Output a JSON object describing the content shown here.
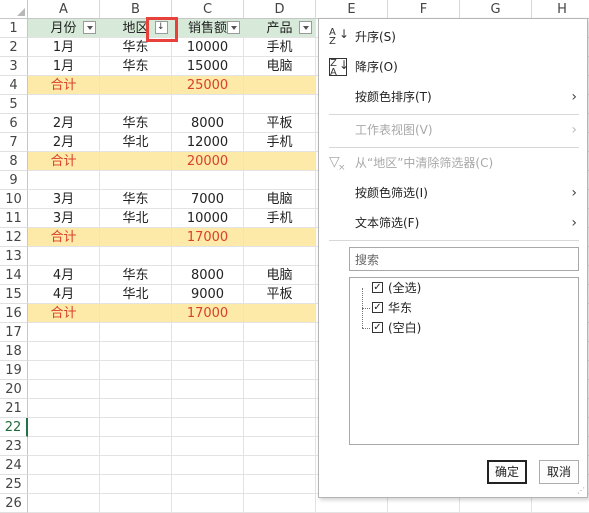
{
  "columns": [
    "A",
    "B",
    "C",
    "D",
    "E",
    "F",
    "G",
    "H"
  ],
  "rows": [
    {
      "n": "1",
      "type": "header",
      "a": "月份",
      "b": "地区",
      "c": "销售额",
      "d": "产品"
    },
    {
      "n": "2",
      "type": "data",
      "a": "1月",
      "b": "华东",
      "c": "10000",
      "d": "手机"
    },
    {
      "n": "3",
      "type": "data",
      "a": "1月",
      "b": "华东",
      "c": "15000",
      "d": "电脑"
    },
    {
      "n": "4",
      "type": "total",
      "a": "合计",
      "b": "",
      "c": "25000",
      "d": ""
    },
    {
      "n": "5",
      "type": "blank",
      "a": "",
      "b": "",
      "c": "",
      "d": ""
    },
    {
      "n": "6",
      "type": "data",
      "a": "2月",
      "b": "华东",
      "c": "8000",
      "d": "平板"
    },
    {
      "n": "7",
      "type": "data",
      "a": "2月",
      "b": "华北",
      "c": "12000",
      "d": "手机"
    },
    {
      "n": "8",
      "type": "total",
      "a": "合计",
      "b": "",
      "c": "20000",
      "d": ""
    },
    {
      "n": "9",
      "type": "blank",
      "a": "",
      "b": "",
      "c": "",
      "d": ""
    },
    {
      "n": "10",
      "type": "data",
      "a": "3月",
      "b": "华东",
      "c": "7000",
      "d": "电脑"
    },
    {
      "n": "11",
      "type": "data",
      "a": "3月",
      "b": "华北",
      "c": "10000",
      "d": "手机"
    },
    {
      "n": "12",
      "type": "total",
      "a": "合计",
      "b": "",
      "c": "17000",
      "d": ""
    },
    {
      "n": "13",
      "type": "blank",
      "a": "",
      "b": "",
      "c": "",
      "d": ""
    },
    {
      "n": "14",
      "type": "data",
      "a": "4月",
      "b": "华东",
      "c": "8000",
      "d": "电脑"
    },
    {
      "n": "15",
      "type": "data",
      "a": "4月",
      "b": "华北",
      "c": "9000",
      "d": "平板"
    },
    {
      "n": "16",
      "type": "total",
      "a": "合计",
      "b": "",
      "c": "17000",
      "d": ""
    },
    {
      "n": "17",
      "type": "blank",
      "a": "",
      "b": "",
      "c": "",
      "d": ""
    },
    {
      "n": "18",
      "type": "blank",
      "a": "",
      "b": "",
      "c": "",
      "d": ""
    },
    {
      "n": "19",
      "type": "blank",
      "a": "",
      "b": "",
      "c": "",
      "d": ""
    },
    {
      "n": "20",
      "type": "blank",
      "a": "",
      "b": "",
      "c": "",
      "d": ""
    },
    {
      "n": "21",
      "type": "blank",
      "a": "",
      "b": "",
      "c": "",
      "d": ""
    },
    {
      "n": "22",
      "type": "blank",
      "a": "",
      "b": "",
      "c": "",
      "d": ""
    },
    {
      "n": "23",
      "type": "blank",
      "a": "",
      "b": "",
      "c": "",
      "d": ""
    },
    {
      "n": "24",
      "type": "blank",
      "a": "",
      "b": "",
      "c": "",
      "d": ""
    },
    {
      "n": "25",
      "type": "blank",
      "a": "",
      "b": "",
      "c": "",
      "d": ""
    },
    {
      "n": "26",
      "type": "blank",
      "a": "",
      "b": "",
      "c": "",
      "d": ""
    }
  ],
  "selected_row": "22",
  "filter_menu": {
    "sort_asc": "升序(S)",
    "sort_desc": "降序(O)",
    "sort_by_color": "按颜色排序(T)",
    "sheet_view": "工作表视图(V)",
    "clear_filter": "从“地区”中清除筛选器(C)",
    "filter_by_color": "按颜色筛选(I)",
    "text_filter": "文本筛选(F)",
    "search_placeholder": "搜索",
    "list": [
      "(全选)",
      "华东",
      "(空白)"
    ],
    "ok": "确定",
    "cancel": "取消"
  },
  "colors": {
    "total_fill": "#fde9a8",
    "total_text": "#d9412a",
    "header_fill": "#d7ead9",
    "highlight_box": "#e8403a",
    "accent": "#217346"
  }
}
